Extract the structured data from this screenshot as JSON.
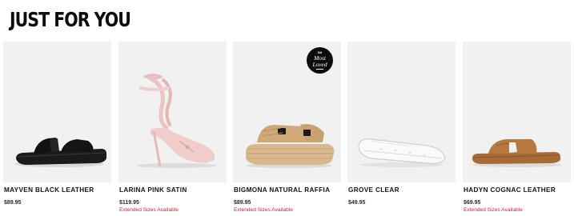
{
  "section": {
    "title": "JUST FOR YOU"
  },
  "products": [
    {
      "name": "MAYVEN BLACK LEATHER",
      "price": "$89.95",
      "extended_sizes": "",
      "image_icon": "black-slide-sandal"
    },
    {
      "name": "LARINA PINK SATIN",
      "price": "$119.95",
      "extended_sizes": "Extended Sizes Available",
      "image_icon": "pink-lace-up-heel"
    },
    {
      "name": "BIGMONA NATURAL RAFFIA",
      "price": "$89.95",
      "extended_sizes": "Extended Sizes Available",
      "image_icon": "raffia-platform-sandal",
      "badge": {
        "line1": "SM",
        "line2": "Most",
        "line3": "Loved"
      }
    },
    {
      "name": "GROVE CLEAR",
      "price": "$49.95",
      "extended_sizes": "",
      "image_icon": "clear-flat"
    },
    {
      "name": "HADYN COGNAC LEATHER",
      "price": "$69.95",
      "extended_sizes": "Extended Sizes Available",
      "image_icon": "cognac-slide-sandal"
    }
  ],
  "colors": {
    "accent_red": "#c0263a",
    "card_background": "#f1f1f1",
    "title": "#0d0d0d"
  }
}
